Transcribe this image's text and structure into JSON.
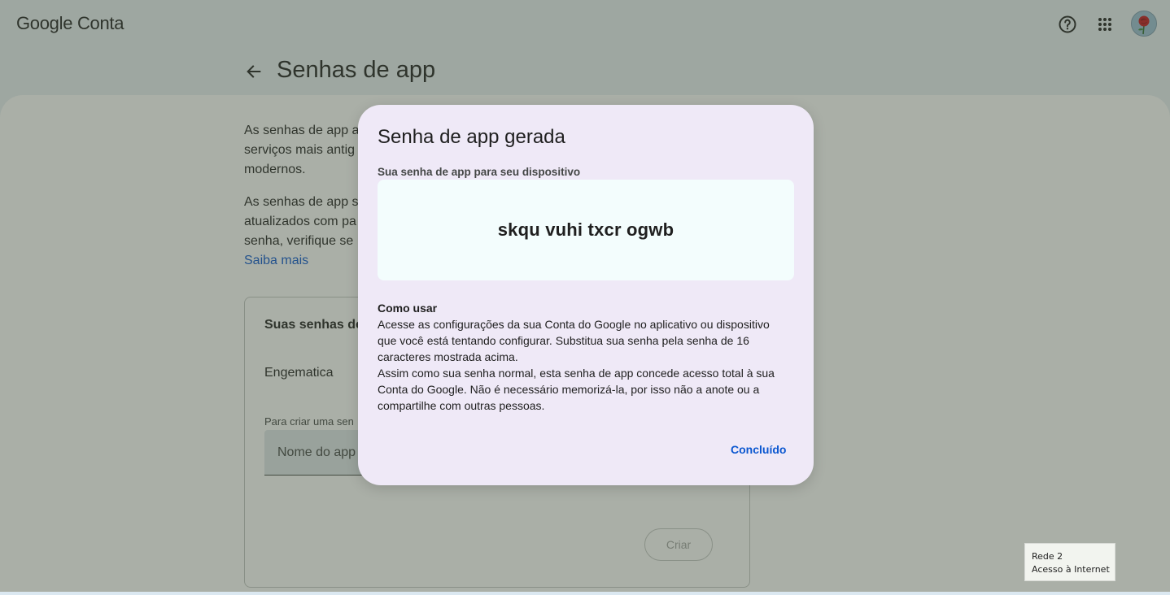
{
  "header": {
    "brand_google": "Google",
    "brand_product": "Conta",
    "help_icon": "help-circle-icon",
    "apps_icon": "apps-grid-icon",
    "avatar_icon": "rose-avatar-icon"
  },
  "page": {
    "back_icon": "arrow-left-icon",
    "title": "Senhas de app",
    "paragraph1_lines": [
      "As senhas de app a",
      "serviços mais antig",
      "modernos."
    ],
    "paragraph2_lines": [
      "As senhas de app s",
      "atualizados com pa",
      "senha, verifique se"
    ],
    "learn_more": "Saiba mais",
    "card": {
      "title": "Suas senhas de",
      "app_name": "Engematica",
      "create_hint": "Para criar uma sen",
      "input_placeholder": "Nome do app",
      "create_button": "Criar"
    }
  },
  "dialog": {
    "title": "Senha de app gerada",
    "subtitle": "Sua senha de app para seu dispositivo",
    "password": "skqu vuhi txcr ogwb",
    "howto_title": "Como usar",
    "howto_lines": [
      "Acesse as configurações da sua Conta do Google no aplicativo ou dispositivo",
      "que você está tentando configurar. Substitua sua senha pela senha de 16",
      "caracteres mostrada acima.",
      "Assim como sua senha normal, esta senha de app concede acesso total à sua",
      "Conta do Google. Não é necessário memorizá-la, por isso não a anote ou a",
      "compartilhe com outras pessoas."
    ],
    "done_button": "Concluído"
  },
  "network_tooltip": {
    "line1": "Rede 2",
    "line2": "Acesso à Internet"
  },
  "colors": {
    "accent": "#0b57d0",
    "dialog_bg": "#efe9f7",
    "password_bg": "#f3fdfd",
    "text": "#1f1f1f"
  }
}
